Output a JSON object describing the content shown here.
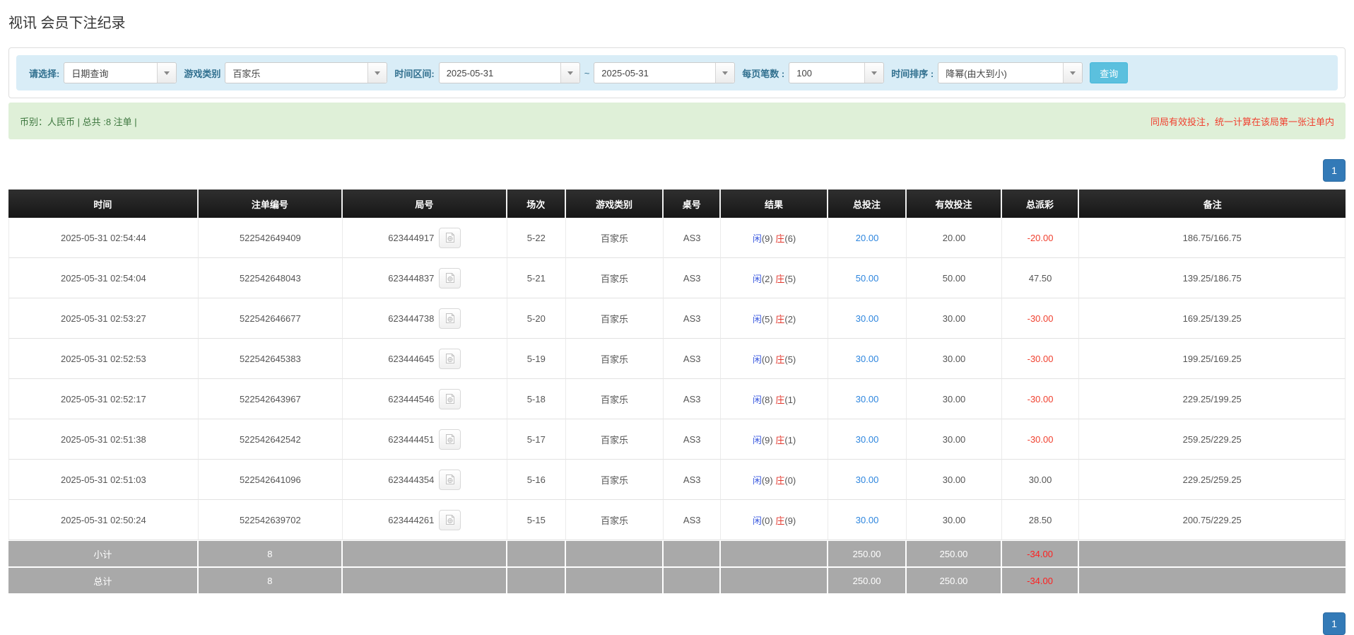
{
  "page": {
    "title": "视讯 会员下注纪录"
  },
  "filters": {
    "select_label": "请选择:",
    "select_value": "日期查询",
    "game_label": "游戏类别",
    "game_value": "百家乐",
    "range_label": "时间区间:",
    "date_from": "2025-05-31",
    "range_separator": "~",
    "date_to": "2025-05-31",
    "page_size_label": "每页笔数 :",
    "page_size_value": "100",
    "sort_label": "时间排序 :",
    "sort_value": "降幂(由大到小)",
    "search_button": "查询"
  },
  "summary": {
    "left_text": "币别：人民币 | 总共 :8 注单 |",
    "right_text": "同局有效投注，统一计算在该局第一张注单内"
  },
  "pagination": {
    "page": "1"
  },
  "colors": {
    "filter_bg": "#d9edf7",
    "label_blue": "#31708f",
    "search_button_bg": "#5bc0de",
    "summary_bg": "#dff0d8",
    "summary_text_green": "#3c763d",
    "warning_red": "#f0402f",
    "header_bg": "#1e1e1e",
    "footer_gray": "#a9a9a9",
    "link_blue": "#2e86de",
    "player_blue": "#3c5be0",
    "banker_red": "#e3382e",
    "pager_blue": "#337ab7"
  },
  "table": {
    "headers": [
      "时间",
      "注单编号",
      "局号",
      "场次",
      "游戏类别",
      "桌号",
      "结果",
      "总投注",
      "有效投注",
      "总派彩",
      "备注"
    ],
    "rows": [
      {
        "time": "2025-05-31 02:54:44",
        "bet_id": "522542649409",
        "round": "623444917",
        "session": "5-22",
        "game": "百家乐",
        "table_no": "AS3",
        "p": "闲",
        "pn": "(9)",
        "b": "庄",
        "bn": "(6)",
        "total_bet": "20.00",
        "valid_bet": "20.00",
        "payout": "-20.00",
        "note": "186.75/166.75"
      },
      {
        "time": "2025-05-31 02:54:04",
        "bet_id": "522542648043",
        "round": "623444837",
        "session": "5-21",
        "game": "百家乐",
        "table_no": "AS3",
        "p": "闲",
        "pn": "(2)",
        "b": "庄",
        "bn": "(5)",
        "total_bet": "50.00",
        "valid_bet": "50.00",
        "payout": "47.50",
        "note": "139.25/186.75"
      },
      {
        "time": "2025-05-31 02:53:27",
        "bet_id": "522542646677",
        "round": "623444738",
        "session": "5-20",
        "game": "百家乐",
        "table_no": "AS3",
        "p": "闲",
        "pn": "(5)",
        "b": "庄",
        "bn": "(2)",
        "total_bet": "30.00",
        "valid_bet": "30.00",
        "payout": "-30.00",
        "note": "169.25/139.25"
      },
      {
        "time": "2025-05-31 02:52:53",
        "bet_id": "522542645383",
        "round": "623444645",
        "session": "5-19",
        "game": "百家乐",
        "table_no": "AS3",
        "p": "闲",
        "pn": "(0)",
        "b": "庄",
        "bn": "(5)",
        "total_bet": "30.00",
        "valid_bet": "30.00",
        "payout": "-30.00",
        "note": "199.25/169.25"
      },
      {
        "time": "2025-05-31 02:52:17",
        "bet_id": "522542643967",
        "round": "623444546",
        "session": "5-18",
        "game": "百家乐",
        "table_no": "AS3",
        "p": "闲",
        "pn": "(8)",
        "b": "庄",
        "bn": "(1)",
        "total_bet": "30.00",
        "valid_bet": "30.00",
        "payout": "-30.00",
        "note": "229.25/199.25"
      },
      {
        "time": "2025-05-31 02:51:38",
        "bet_id": "522542642542",
        "round": "623444451",
        "session": "5-17",
        "game": "百家乐",
        "table_no": "AS3",
        "p": "闲",
        "pn": "(9)",
        "b": "庄",
        "bn": "(1)",
        "total_bet": "30.00",
        "valid_bet": "30.00",
        "payout": "-30.00",
        "note": "259.25/229.25"
      },
      {
        "time": "2025-05-31 02:51:03",
        "bet_id": "522542641096",
        "round": "623444354",
        "session": "5-16",
        "game": "百家乐",
        "table_no": "AS3",
        "p": "闲",
        "pn": "(9)",
        "b": "庄",
        "bn": "(0)",
        "total_bet": "30.00",
        "valid_bet": "30.00",
        "payout": "30.00",
        "note": "229.25/259.25"
      },
      {
        "time": "2025-05-31 02:50:24",
        "bet_id": "522542639702",
        "round": "623444261",
        "session": "5-15",
        "game": "百家乐",
        "table_no": "AS3",
        "p": "闲",
        "pn": "(0)",
        "b": "庄",
        "bn": "(9)",
        "total_bet": "30.00",
        "valid_bet": "30.00",
        "payout": "28.50",
        "note": "200.75/229.25"
      }
    ],
    "footer": [
      {
        "label": "小计",
        "count": "8",
        "total_bet": "250.00",
        "valid_bet": "250.00",
        "payout": "-34.00"
      },
      {
        "label": "总计",
        "count": "8",
        "total_bet": "250.00",
        "valid_bet": "250.00",
        "payout": "-34.00"
      }
    ]
  }
}
